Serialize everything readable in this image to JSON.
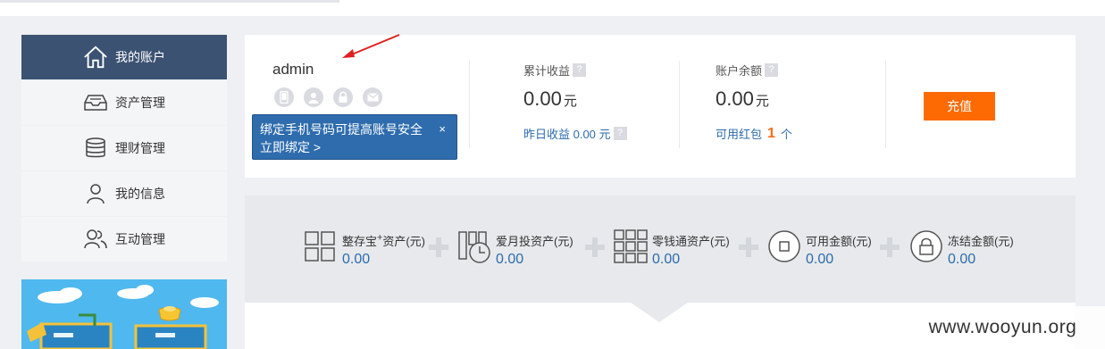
{
  "sidebar": {
    "items": [
      {
        "label": "我的账户",
        "icon": "home-icon",
        "active": true
      },
      {
        "label": "资产管理",
        "icon": "inbox-icon",
        "active": false
      },
      {
        "label": "理财管理",
        "icon": "database-icon",
        "active": false
      },
      {
        "label": "我的信息",
        "icon": "user-icon",
        "active": false
      },
      {
        "label": "互动管理",
        "icon": "users-icon",
        "active": false
      }
    ]
  },
  "account": {
    "username": "admin",
    "security_icons": [
      "phone-icon",
      "person-icon",
      "lock-icon",
      "mail-icon"
    ],
    "tooltip": {
      "message": "绑定手机号码可提高账号安全",
      "link": "立即绑定 >",
      "close": "×"
    },
    "stats": [
      {
        "title": "累计收益",
        "help": "?",
        "value": "0.00",
        "unit": "元",
        "sub_label": "昨日收益 0.00 元",
        "sub_help": "?"
      },
      {
        "title": "账户余额",
        "help": "?",
        "value": "0.00",
        "unit": "元",
        "sub_label": "可用红包",
        "sub_count": "1",
        "sub_unit": "个"
      }
    ],
    "recharge_label": "充值"
  },
  "assets": {
    "items": [
      {
        "label_main": "整存宝",
        "label_sup": "+",
        "label_tail": "资产(元)",
        "value": "0.00"
      },
      {
        "label": "爱月投资产(元)",
        "value": "0.00"
      },
      {
        "label": "零钱通资产(元)",
        "value": "0.00"
      },
      {
        "label": "可用金额(元)",
        "value": "0.00"
      },
      {
        "label": "冻结金额(元)",
        "value": "0.00"
      }
    ]
  },
  "watermark": "www.wooyun.org",
  "colors": {
    "sidebar_active": "#3c5272",
    "link_blue": "#2e6cad",
    "recharge": "#fd6a04",
    "accent_orange": "#f76c1b"
  }
}
